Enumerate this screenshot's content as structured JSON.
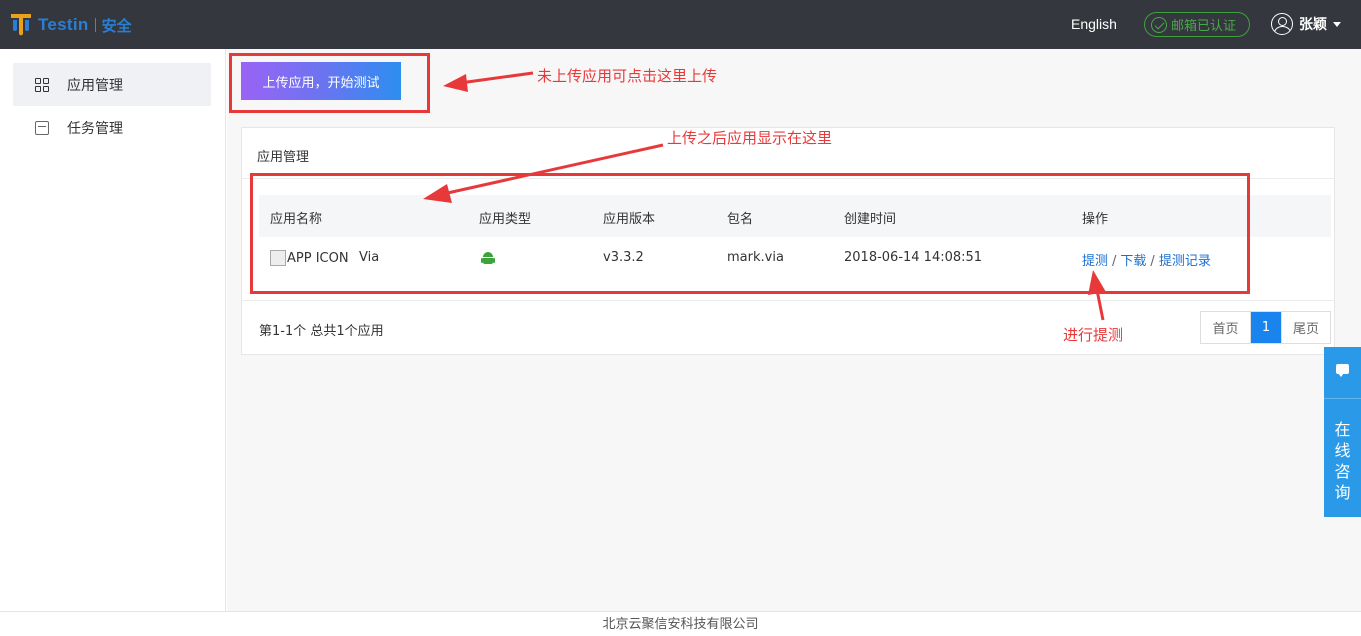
{
  "header": {
    "logo_text": "Testin",
    "logo_sub": "安全",
    "language": "English",
    "email_status": "邮箱已认证",
    "username": "张颖"
  },
  "sidebar": {
    "items": [
      {
        "label": "应用管理",
        "icon": "app-grid-icon",
        "active": true
      },
      {
        "label": "任务管理",
        "icon": "cube-icon",
        "active": false
      }
    ]
  },
  "upload_button": "上传应用，开始测试",
  "panel": {
    "title": "应用管理",
    "columns": [
      "应用名称",
      "应用类型",
      "应用版本",
      "包名",
      "创建时间",
      "操作"
    ],
    "rows": [
      {
        "icon_alt": "APP ICON",
        "name": "Via",
        "type_icon": "android-icon",
        "version": "v3.3.2",
        "package": "mark.via",
        "created": "2018-06-14 14:08:51",
        "actions": [
          "提测",
          "下载",
          "提测记录"
        ]
      }
    ],
    "count_text": "第1-1个 总共1个应用",
    "pager": {
      "first": "首页",
      "current": "1",
      "last": "尾页"
    }
  },
  "annotations": {
    "upload_hint": "未上传应用可点击这里上传",
    "list_hint": "上传之后应用显示在这里",
    "action_hint": "进行提测"
  },
  "float_chat": {
    "chars": [
      "在",
      "线",
      "咨",
      "询"
    ]
  },
  "footer": "北京云聚信安科技有限公司",
  "colors": {
    "header_bg": "#34373d",
    "accent_blue": "#1a84ee",
    "annotation_red": "#e8393a",
    "verified_green": "#49a84a"
  }
}
